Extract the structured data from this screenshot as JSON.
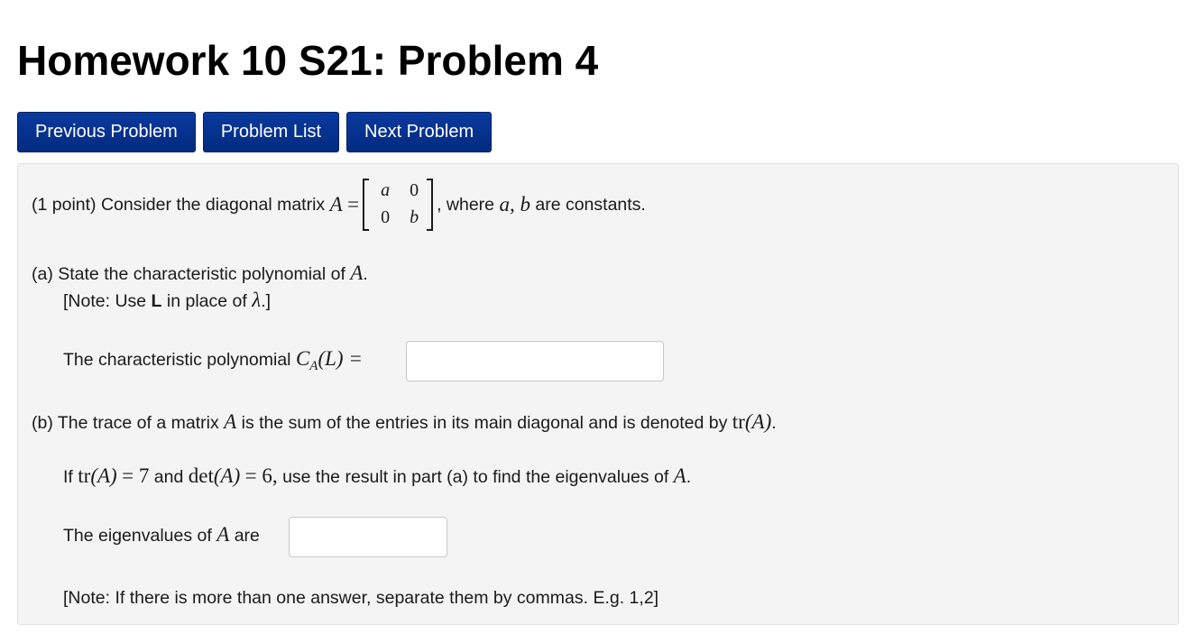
{
  "title": "Homework 10 S21: Problem 4",
  "nav": {
    "previous": "Previous Problem",
    "list": "Problem List",
    "next": "Next Problem"
  },
  "problem": {
    "intro_pre": "(1 point) Consider the diagonal matrix",
    "matrix_name": "A",
    "equals": "=",
    "matrix": {
      "a11": "a",
      "a12": "0",
      "a21": "0",
      "a22": "b"
    },
    "intro_post_1": ", where",
    "intro_vars": "a, b",
    "intro_post_2": "are constants.",
    "part_a_pre": "(a) State the characteristic polynomial of",
    "part_a_var": "A",
    "period": ".",
    "note_a_pre": "[Note: Use",
    "note_a_bold": "L",
    "note_a_mid": "in place of",
    "note_a_lambda": "λ",
    "note_a_post": ".]",
    "charpoly_label": "The characteristic polynomial",
    "charpoly_C": "C",
    "charpoly_sub": "A",
    "charpoly_arg": "(L) =",
    "charpoly_value": "",
    "part_b_pre": "(b) The trace of a matrix",
    "part_b_var": "A",
    "part_b_post": "is the sum of the entries in its main diagonal and is denoted by",
    "part_b_tr": "tr",
    "part_b_tr_arg": "(A)",
    "given_if": "If",
    "given_tr": "tr",
    "given_tr_arg": "(A)",
    "given_tr_val": "= 7",
    "given_and": "and",
    "given_det": "det",
    "given_det_arg": "(A)",
    "given_det_val": "= 6,",
    "given_post": "use the result in part (a) to find the eigenvalues of",
    "given_var": "A",
    "eig_label_pre": "The eigenvalues of",
    "eig_var": "A",
    "eig_label_post": "are",
    "eig_value": "",
    "note_b": "[Note: If there is more than one answer, separate them by commas. E.g. 1,2]"
  }
}
